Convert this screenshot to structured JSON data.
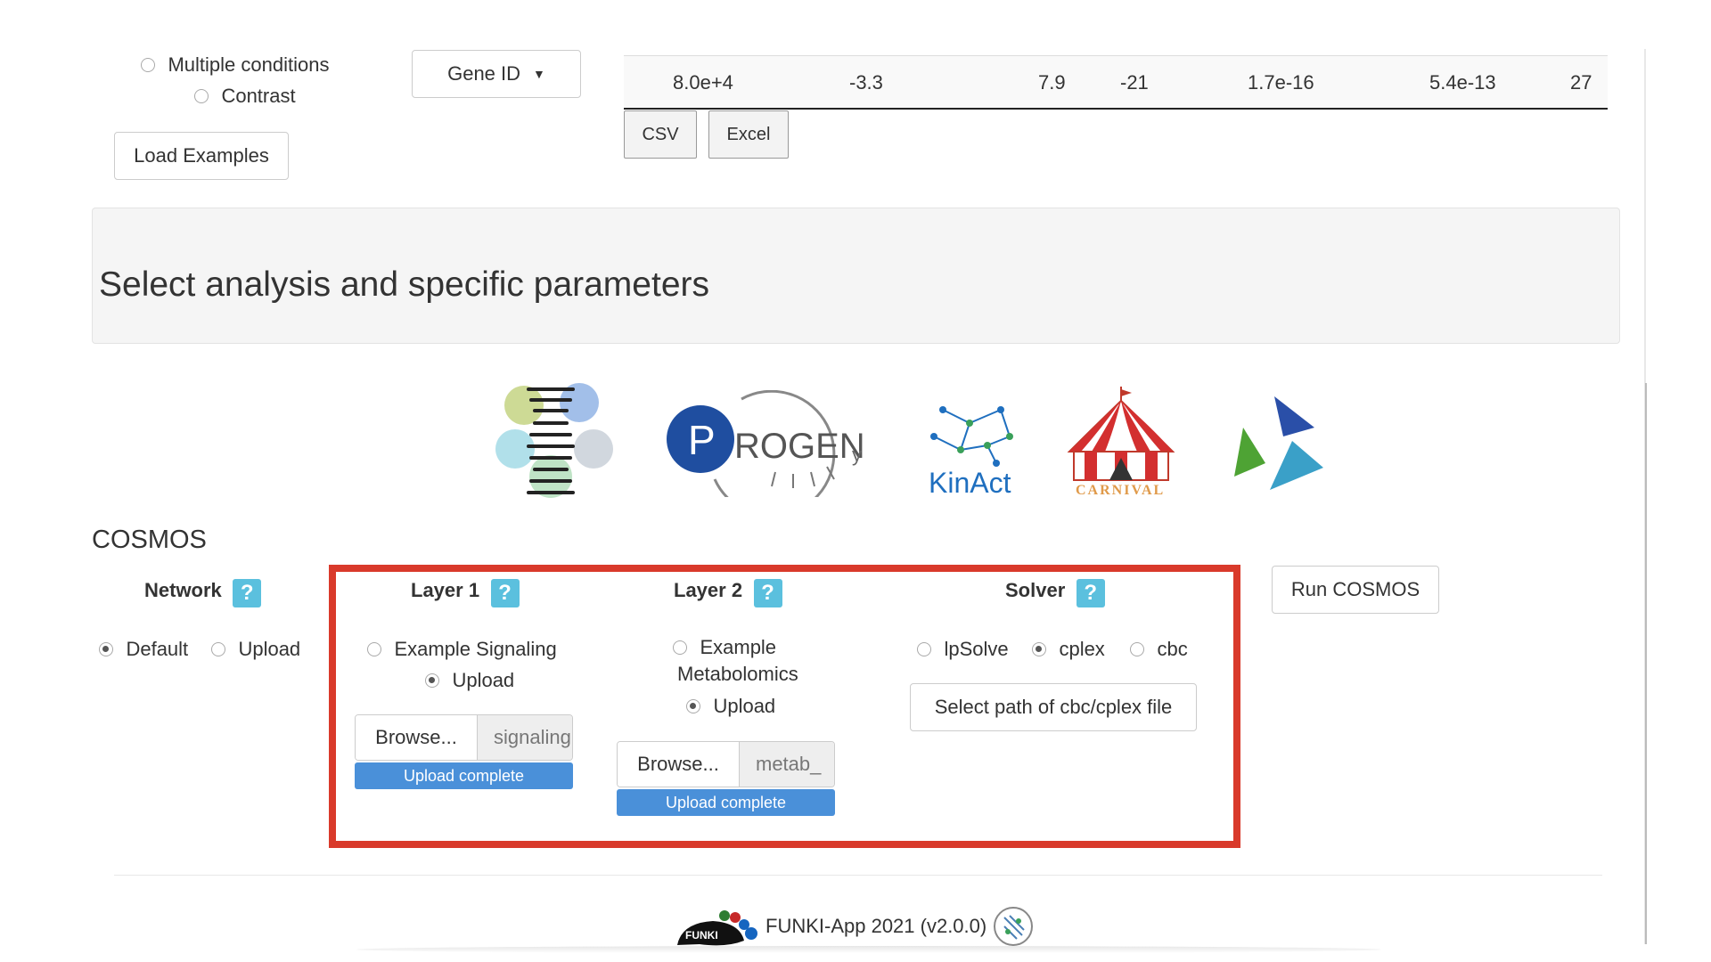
{
  "input_panel": {
    "radio_multiple": "Multiple conditions",
    "radio_contrast": "Contrast",
    "gene_id_dropdown": "Gene ID",
    "load_examples_button": "Load Examples"
  },
  "results_table": {
    "row": [
      "8.0e+4",
      "-3.3",
      "7.9",
      "-21",
      "1.7e-16",
      "5.4e-13",
      "27"
    ],
    "csv_button": "CSV",
    "excel_button": "Excel"
  },
  "analysis_panel": {
    "title": "Select analysis and specific parameters"
  },
  "tools": [
    {
      "name": "dorothea-logo"
    },
    {
      "name": "progeny-logo",
      "text": "ROGEN"
    },
    {
      "name": "kinact-logo",
      "text": "KinAct"
    },
    {
      "name": "carnival-logo",
      "text": "CARNIVAL"
    },
    {
      "name": "cosmos-logo"
    }
  ],
  "cosmos": {
    "title": "COSMOS",
    "network": {
      "label": "Network",
      "default": "Default",
      "upload": "Upload",
      "selected": "Default"
    },
    "layer1": {
      "label": "Layer 1",
      "example": "Example Signaling",
      "upload": "Upload",
      "selected": "Upload",
      "browse": "Browse...",
      "filename": "signaling",
      "progress": "Upload complete",
      "progress_value": 1.0
    },
    "layer2": {
      "label": "Layer 2",
      "example_line1": "Example",
      "example_line2": "Metabolomics",
      "upload": "Upload",
      "selected": "Upload",
      "browse": "Browse...",
      "filename": "metab_",
      "progress": "Upload complete",
      "progress_value": 1.0
    },
    "solver": {
      "label": "Solver",
      "options": [
        "lpSolve",
        "cplex",
        "cbc"
      ],
      "selected": "cplex",
      "path_button": "Select path of cbc/cplex file"
    },
    "help_icon": "?",
    "run_button": "Run COSMOS"
  },
  "footer": {
    "text": "FUNKI-App 2021 (v2.0.0)",
    "logo_text": "FUNKI"
  },
  "colors": {
    "highlight_border": "#d93a2b",
    "help_icon": "#5bc0de",
    "progress": "#4a90d9"
  }
}
